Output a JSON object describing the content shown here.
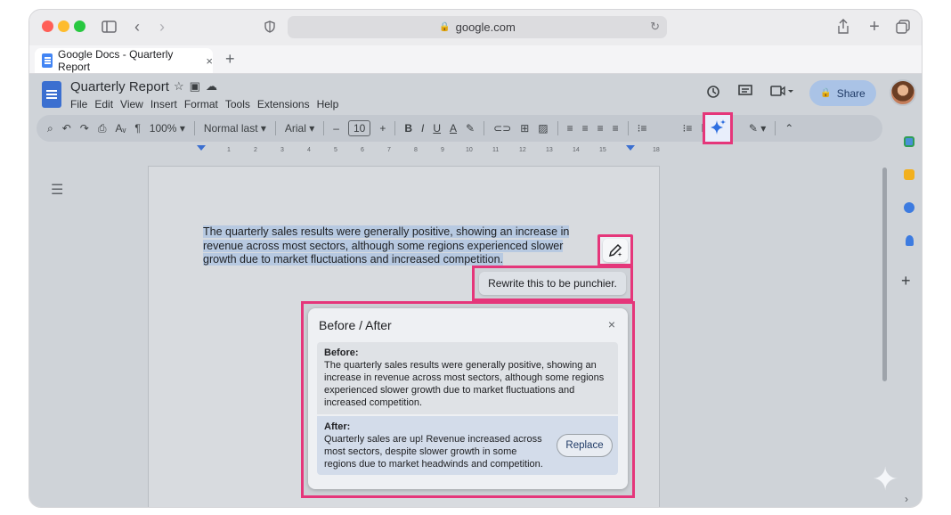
{
  "browser": {
    "url": "google.com",
    "tab_title": "Google Docs - Quarterly Report",
    "new_tab_symbol": "+",
    "tab_close_symbol": "×"
  },
  "doc": {
    "title": "Quarterly Report",
    "menu": [
      "File",
      "Edit",
      "View",
      "Insert",
      "Format",
      "Tools",
      "Extensions",
      "Help"
    ],
    "share_label": "Share"
  },
  "toolbar": {
    "zoom": "100%",
    "style": "Normal last",
    "font": "Arial",
    "font_size": "10",
    "minus": "–",
    "plus": "+",
    "bold": "B",
    "italic": "I",
    "underline": "U",
    "text_color": "A"
  },
  "ruler": {
    "ticks": [
      "1",
      "2",
      "3",
      "4",
      "5",
      "6",
      "7",
      "8",
      "9",
      "10",
      "11",
      "12",
      "13",
      "14",
      "15",
      "18"
    ]
  },
  "body": {
    "selected_text": "The quarterly sales results were generally positive, showing an increase in revenue across most sectors, although some regions experienced slower growth due to market fluctuations and increased competition."
  },
  "prompt": {
    "text": "Rewrite this to be punchier."
  },
  "before_after": {
    "title": "Before / After",
    "close": "×",
    "before_label": "Before:",
    "before_text": "The quarterly sales results were generally positive, showing an increase in revenue across most sectors, although some regions experienced slower growth due to market fluctuations and increased competition.",
    "after_label": "After:",
    "after_text": "Quarterly sales are up! Revenue increased across most sectors, despite slower growth in some regions due to market headwinds and competition.",
    "replace_label": "Replace"
  },
  "colors": {
    "highlight_border": "#e5367a",
    "share_bg": "#aac3e6",
    "selection": "#b7c9e1"
  },
  "icons": [
    "sidebar-icon",
    "back-icon",
    "forward-icon",
    "shield-icon",
    "lock-icon",
    "reload-icon",
    "share-sheet-icon",
    "plus-icon",
    "tabs-icon",
    "history-icon",
    "comment-icon",
    "meet-icon",
    "star-icon",
    "folder-icon",
    "cloud-icon",
    "gemini-sparkle-icon",
    "pen-sparkle-icon",
    "outline-icon"
  ]
}
